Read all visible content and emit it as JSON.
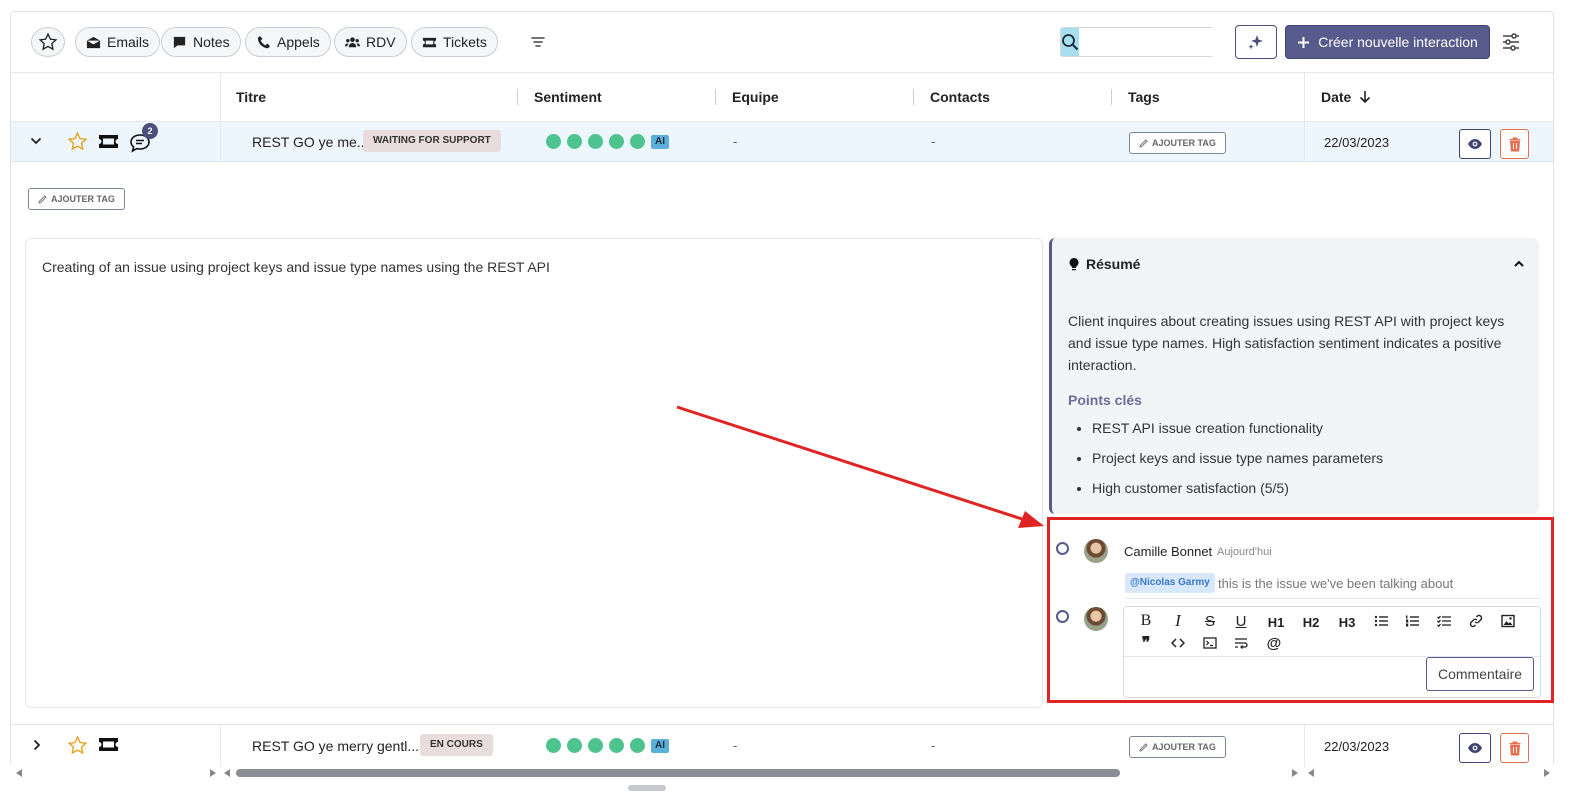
{
  "toolbar": {
    "chips": [
      {
        "label": "Emails",
        "icon": "envelope-icon"
      },
      {
        "label": "Notes",
        "icon": "note-icon"
      },
      {
        "label": "Appels",
        "icon": "phone-icon"
      },
      {
        "label": "RDV",
        "icon": "users-icon"
      },
      {
        "label": "Tickets",
        "icon": "ticket-icon"
      }
    ],
    "search_value": "",
    "create_label": "Créer nouvelle interaction"
  },
  "table": {
    "columns": [
      "Titre",
      "Sentiment",
      "Equipe",
      "Contacts",
      "Tags",
      "Date"
    ],
    "rows": [
      {
        "title": "REST GO ye me...",
        "status": "WAITING FOR SUPPORT",
        "sentiment_score": 5,
        "ai": "AI",
        "equipe": "-",
        "contacts": "-",
        "tag_button": "AJOUTER TAG",
        "date": "22/03/2023",
        "comment_count": "2"
      },
      {
        "title": "REST GO ye merry gentl...",
        "status": "EN COURS",
        "sentiment_score": 5,
        "ai": "AI",
        "equipe": "-",
        "contacts": "-",
        "tag_button": "AJOUTER TAG",
        "date": "22/03/2023"
      }
    ]
  },
  "detail": {
    "tag_button": "AJOUTER TAG",
    "description": "Creating of an issue using project keys and issue type names using the REST API",
    "summary_title": "Résumé",
    "summary_text": "Client inquires about creating issues using REST API with project keys and issue type names. High satisfaction sentiment indicates a positive interaction.",
    "points_title": "Points clés",
    "points": [
      "REST API issue creation functionality",
      "Project keys and issue type names parameters",
      "High customer satisfaction (5/5)"
    ]
  },
  "comment": {
    "author": "Camille Bonnet",
    "time": "Aujourd'hui",
    "mention": "@Nicolas Garmy",
    "text": "this is the issue we've been talking about",
    "editor_tools": [
      "B",
      "I",
      "S",
      "U",
      "H1",
      "H2",
      "H3"
    ],
    "submit_label": "Commentaire"
  },
  "colors": {
    "accent": "#565b8c",
    "sentiment": "#4fc38f",
    "highlight": "#e02424",
    "danger": "#e86f4d"
  }
}
